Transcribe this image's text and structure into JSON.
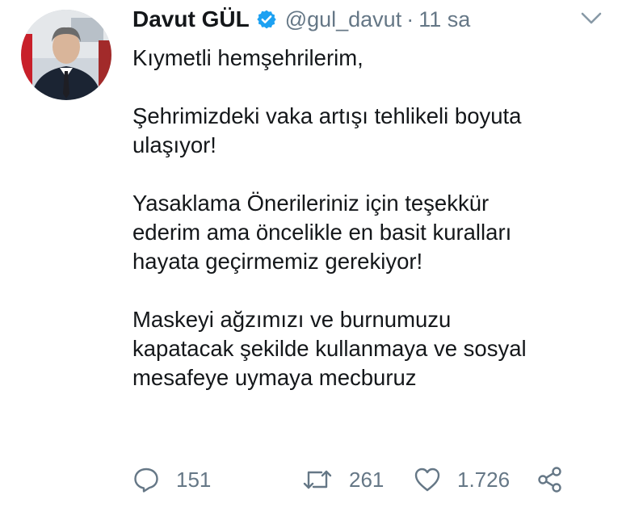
{
  "tweet": {
    "author": {
      "name": "Davut GÜL",
      "handle": "@gul_davut",
      "verified": true,
      "avatar_icon": "profile-photo"
    },
    "separator": "·",
    "timestamp": "11 sa",
    "menu_icon": "chevron-down-icon",
    "paragraphs": [
      [
        "Kıymetli hemşehrilerim,"
      ],
      [
        "Şehrimizdeki vaka artışı tehlikeli boyuta",
        "ulaşıyor!"
      ],
      [
        "Yasaklama Önerileriniz için teşekkür",
        "ederim ama  öncelikle en basit kuralları",
        "hayata geçirmemiz gerekiyor!"
      ],
      [
        "Maskeyi ağzımızı ve burnumuzu",
        "kapatacak şekilde kullanmaya ve sosyal",
        "mesafeye uymaya mecburuz"
      ]
    ],
    "actions": {
      "replies": "151",
      "retweets": "261",
      "likes": "1.726"
    }
  },
  "colors": {
    "text": "#14171a",
    "muted": "#657786",
    "verified_blue": "#1da1f2"
  }
}
